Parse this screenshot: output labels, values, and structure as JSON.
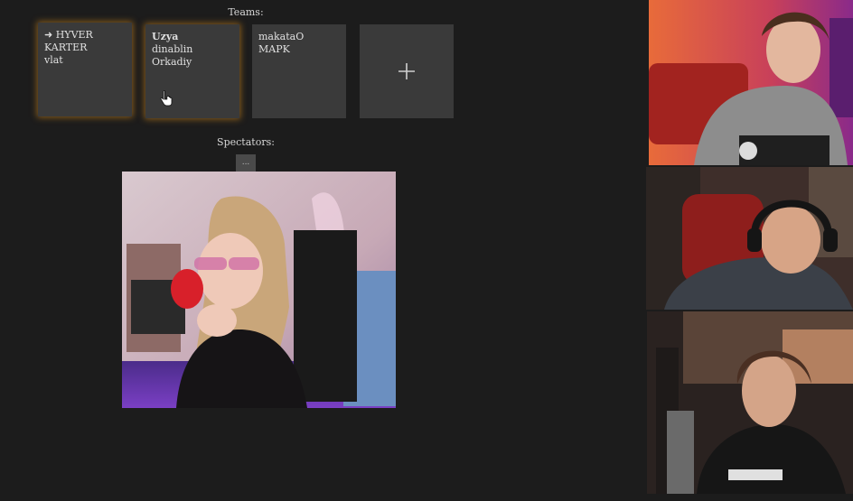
{
  "teams": {
    "heading": "Teams:",
    "cards": [
      {
        "members": [
          "➜ HYVER",
          "KARTER",
          "vlat"
        ],
        "highlighted": true
      },
      {
        "members": [
          "Uzya",
          "dinablin",
          "Orkadiy"
        ],
        "highlighted": true,
        "bold_first": true
      },
      {
        "members": [
          "makataO",
          "MAPK"
        ],
        "highlighted": false
      }
    ],
    "add_icon": "plus-icon"
  },
  "spectators": {
    "heading": "Spectators:",
    "more_label": "..."
  },
  "accent_color": "#c9821c"
}
